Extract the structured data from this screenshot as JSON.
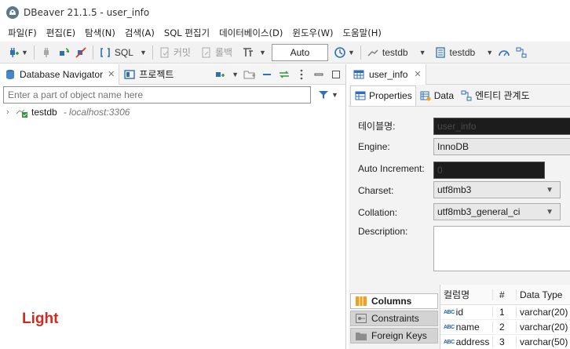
{
  "window": {
    "title": "DBeaver 21.1.5 - user_info"
  },
  "menu": [
    "파일(F)",
    "편집(E)",
    "탐색(N)",
    "검색(A)",
    "SQL 편집기",
    "데이터베이스(D)",
    "윈도우(W)",
    "도움말(H)"
  ],
  "toolbar": {
    "sql_label": "SQL",
    "commit_label": "커밋",
    "rollback_label": "롤백",
    "auto_label": "Auto",
    "datasource_label": "testdb",
    "schema_label": "testdb"
  },
  "navigator": {
    "tab_label": "Database Navigator",
    "project_tab_label": "프로젝트",
    "filter_placeholder": "Enter a part of object name here",
    "tree": [
      {
        "name": "testdb",
        "host": "- localhost:3306"
      }
    ]
  },
  "editor": {
    "tab_label": "user_info",
    "subtabs": [
      "Properties",
      "Data",
      "엔티티 관계도"
    ],
    "properties": {
      "table_name_label": "테이블명:",
      "table_name_value": "user_info",
      "engine_label": "Engine:",
      "engine_value": "InnoDB",
      "auto_inc_label": "Auto Increment:",
      "auto_inc_value": "0",
      "charset_label": "Charset:",
      "charset_value": "utf8mb3",
      "collation_label": "Collation:",
      "collation_value": "utf8mb3_general_ci",
      "description_label": "Description:"
    },
    "side_tabs": [
      "Columns",
      "Constraints",
      "Foreign Keys"
    ],
    "columns_header": [
      "컬럼명",
      "#",
      "Data Type"
    ],
    "columns": [
      {
        "name": "id",
        "num": "1",
        "type": "varchar(20)"
      },
      {
        "name": "name",
        "num": "2",
        "type": "varchar(20)"
      },
      {
        "name": "address",
        "num": "3",
        "type": "varchar(50)"
      }
    ]
  },
  "overlay_label": "Light",
  "colors": {
    "accent_red": "#d12b1f",
    "link_blue": "#2a66b8"
  }
}
